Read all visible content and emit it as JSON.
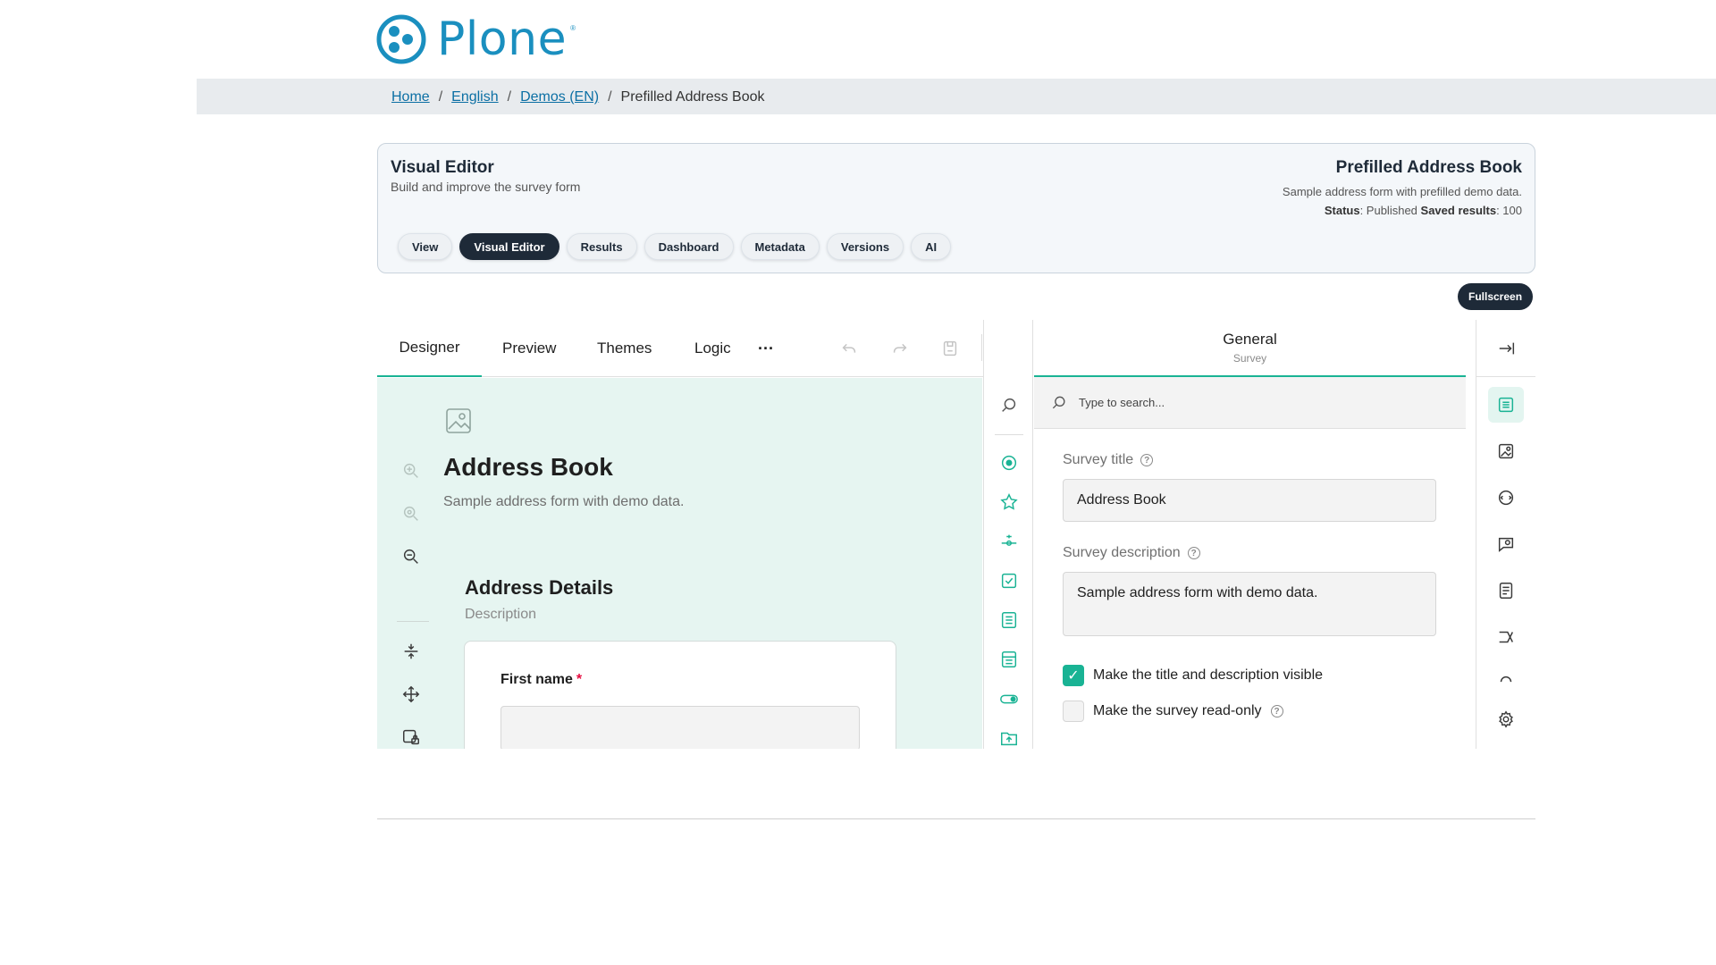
{
  "brand": {
    "name": "Plone",
    "registered": "®",
    "color": "#1a8fbf"
  },
  "breadcrumb": {
    "items": [
      {
        "label": "Home"
      },
      {
        "label": "English"
      },
      {
        "label": "Demos (EN)"
      }
    ],
    "current": "Prefilled Address Book",
    "separator": "/"
  },
  "context": {
    "title": "Visual Editor",
    "subtitle": "Build and improve the survey form",
    "object_title": "Prefilled Address Book",
    "object_description": "Sample address form with prefilled demo data.",
    "status_label": "Status",
    "status_value": ": Published",
    "saved_label": "Saved results",
    "saved_value": ": 100",
    "tabs": [
      {
        "label": "View"
      },
      {
        "label": "Visual Editor",
        "active": true
      },
      {
        "label": "Results"
      },
      {
        "label": "Dashboard"
      },
      {
        "label": "Metadata"
      },
      {
        "label": "Versions"
      },
      {
        "label": "AI"
      }
    ],
    "fullscreen_label": "Fullscreen"
  },
  "creator": {
    "accent": "#19b394",
    "tabs": [
      {
        "label": "Designer",
        "active": true
      },
      {
        "label": "Preview"
      },
      {
        "label": "Themes"
      },
      {
        "label": "Logic"
      }
    ],
    "more_label": "···",
    "survey": {
      "title": "Address Book",
      "description": "Sample address form with demo data."
    },
    "page": {
      "title": "Address Details",
      "description": "Description"
    },
    "question": {
      "title": "First name",
      "required_mark": "*"
    },
    "property_grid": {
      "title": "General",
      "subtitle": "Survey",
      "search_placeholder": "Type to search...",
      "survey_title_label": "Survey title",
      "survey_title_value": "Address Book",
      "survey_description_label": "Survey description",
      "survey_description_value": "Sample address form with demo data.",
      "check_visible_label": "Make the title and description visible",
      "check_visible_value": true,
      "check_readonly_label": "Make the survey read-only",
      "check_readonly_value": false
    }
  }
}
